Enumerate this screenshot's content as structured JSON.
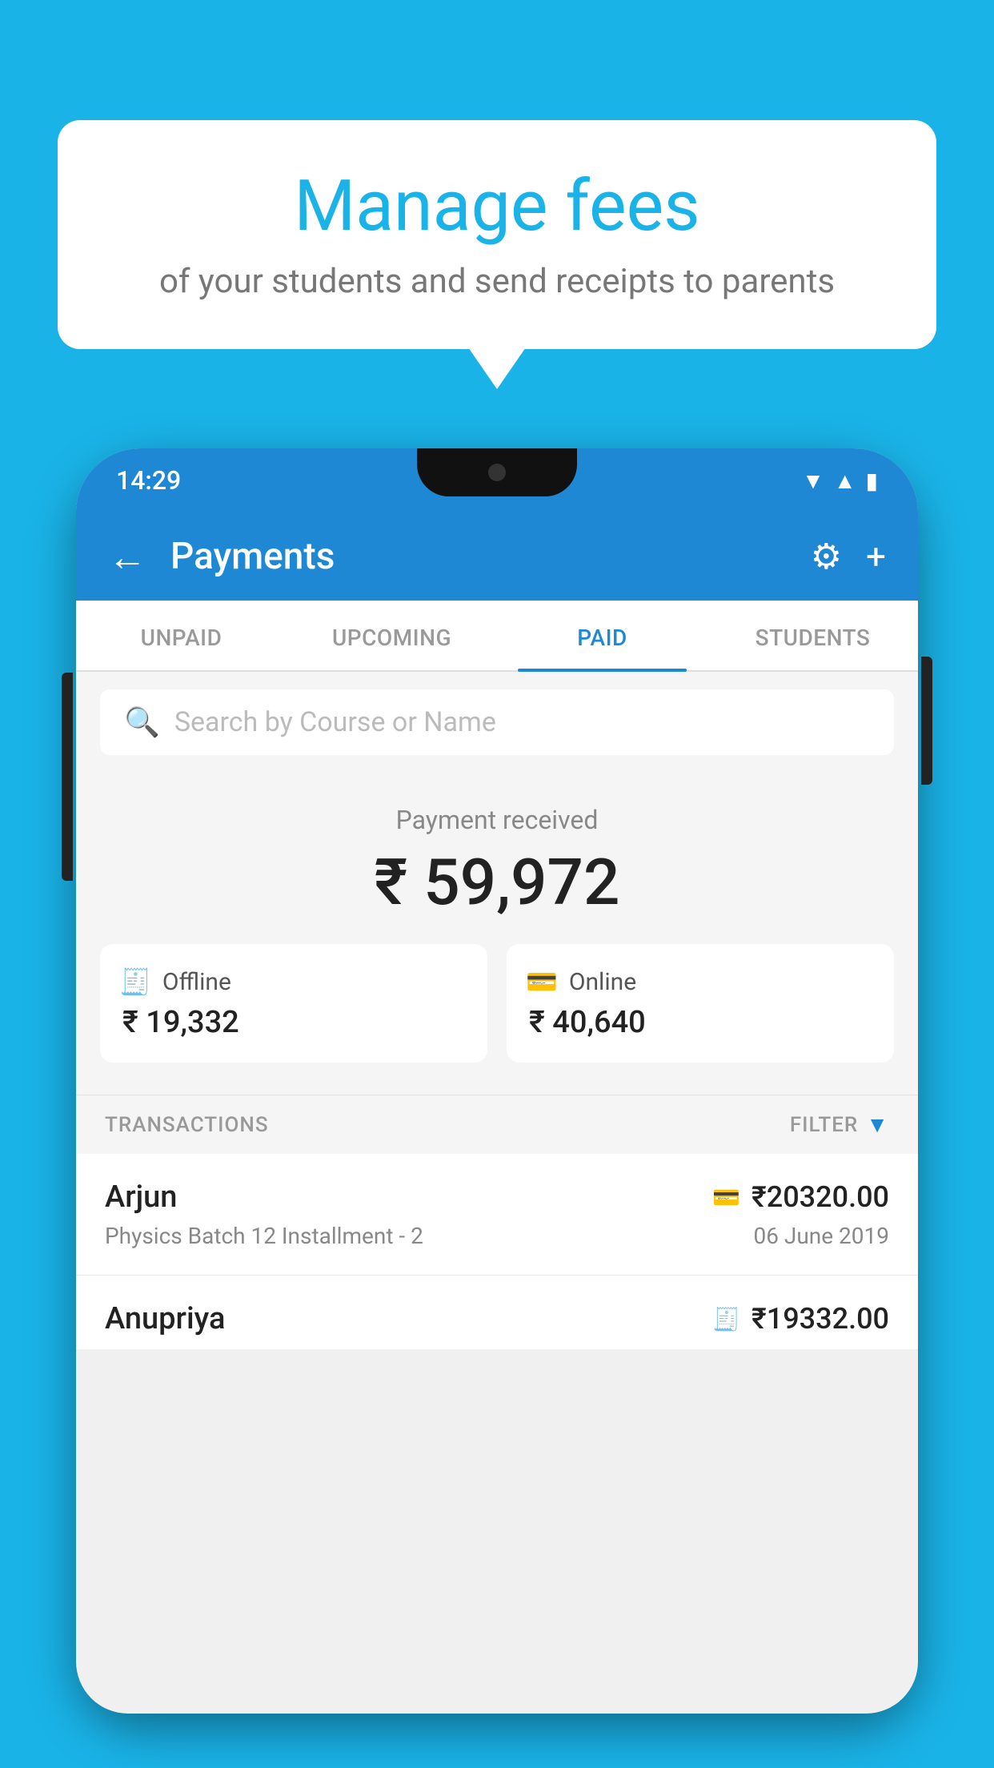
{
  "background_color": "#1ab3e8",
  "speech_bubble": {
    "title": "Manage fees",
    "subtitle": "of your students and send receipts to parents"
  },
  "status_bar": {
    "time": "14:29"
  },
  "app_bar": {
    "title": "Payments",
    "back_label": "←",
    "gear_label": "⚙",
    "plus_label": "+"
  },
  "tabs": [
    {
      "label": "UNPAID",
      "active": false
    },
    {
      "label": "UPCOMING",
      "active": false
    },
    {
      "label": "PAID",
      "active": true
    },
    {
      "label": "STUDENTS",
      "active": false
    }
  ],
  "search": {
    "placeholder": "Search by Course or Name"
  },
  "payment_summary": {
    "label": "Payment received",
    "amount": "₹ 59,972",
    "offline": {
      "type": "Offline",
      "amount": "₹ 19,332"
    },
    "online": {
      "type": "Online",
      "amount": "₹ 40,640"
    }
  },
  "transactions": {
    "header_label": "TRANSACTIONS",
    "filter_label": "FILTER",
    "rows": [
      {
        "name": "Arjun",
        "amount": "₹20320.00",
        "course": "Physics Batch 12 Installment - 2",
        "date": "06 June 2019",
        "payment_method": "card"
      }
    ],
    "partial_row": {
      "name": "Anupriya",
      "amount": "₹19332.00",
      "payment_method": "offline"
    }
  }
}
